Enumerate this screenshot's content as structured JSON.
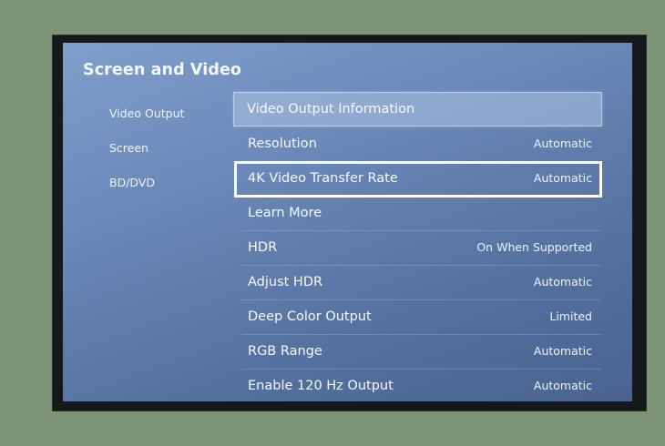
{
  "screen": {
    "title": "Screen and Video"
  },
  "side_nav": [
    {
      "label": "Video Output"
    },
    {
      "label": "Screen"
    },
    {
      "label": "BD/DVD"
    }
  ],
  "menu": [
    {
      "label": "Video Output Information",
      "value": ""
    },
    {
      "label": "Resolution",
      "value": "Automatic"
    },
    {
      "label": "4K Video Transfer Rate",
      "value": "Automatic",
      "focused": true
    },
    {
      "label": "Learn More",
      "value": ""
    },
    {
      "label": "HDR",
      "value": "On When Supported"
    },
    {
      "label": "Adjust HDR",
      "value": "Automatic"
    },
    {
      "label": "Deep Color Output",
      "value": "Limited"
    },
    {
      "label": "RGB Range",
      "value": "Automatic"
    },
    {
      "label": "Enable 120 Hz Output",
      "value": "Automatic"
    }
  ]
}
